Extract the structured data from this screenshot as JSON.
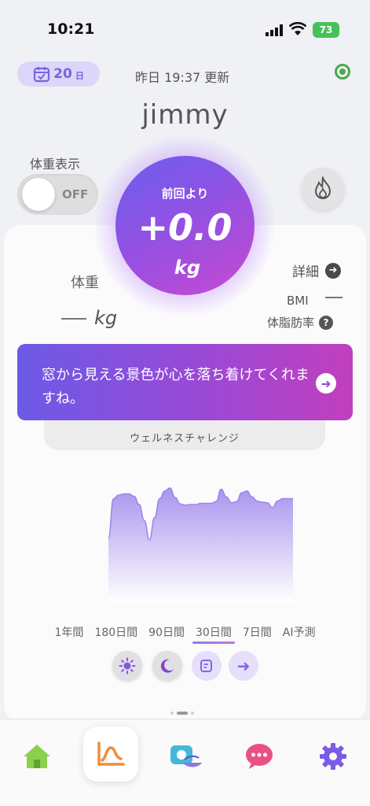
{
  "status_bar": {
    "time": "10:21",
    "battery": "73"
  },
  "header": {
    "day_count": "20",
    "day_unit": "日",
    "updated": "昨日 19:37 更新",
    "username": "jimmy"
  },
  "weight_display": {
    "label": "体重表示",
    "toggle_state": "OFF"
  },
  "change_circle": {
    "label": "前回より",
    "value": "+0.0",
    "unit": "kg"
  },
  "stats": {
    "weight_label": "体重",
    "weight_unit": "kg",
    "detail_label": "詳細",
    "bmi_label": "BMI",
    "body_fat_label": "体脂肪率"
  },
  "banner": {
    "message": "窓から見える景色が心を落ち着けてくれますね。",
    "challenge_label": "ウェルネスチャレンジ"
  },
  "chart_data": {
    "type": "area",
    "values": [
      0.15,
      0.82,
      0.88,
      0.9,
      0.9,
      0.86,
      0.72,
      0.45,
      0.12,
      0.5,
      0.82,
      0.95,
      1.0,
      0.84,
      0.73,
      0.71,
      0.72,
      0.72,
      0.74,
      0.74,
      0.74,
      0.77,
      0.98,
      0.85,
      0.75,
      0.77,
      0.92,
      0.95,
      0.85,
      0.78,
      0.76,
      0.75,
      0.67,
      0.78,
      0.82,
      0.82,
      0.82
    ],
    "colors": {
      "top": "#a994ee",
      "bottom": "#ffffff"
    }
  },
  "ranges": {
    "items": [
      "1年間",
      "180日間",
      "90日間",
      "30日間",
      "7日間",
      "AI予測"
    ],
    "active_index": 3
  },
  "actions": [
    "sun-icon",
    "moon-icon",
    "note-icon",
    "arrow-right-icon"
  ],
  "nav": {
    "items": [
      "home-icon",
      "chart-icon",
      "meal-camera-icon",
      "chat-icon",
      "settings-icon"
    ],
    "active_index": 1
  }
}
